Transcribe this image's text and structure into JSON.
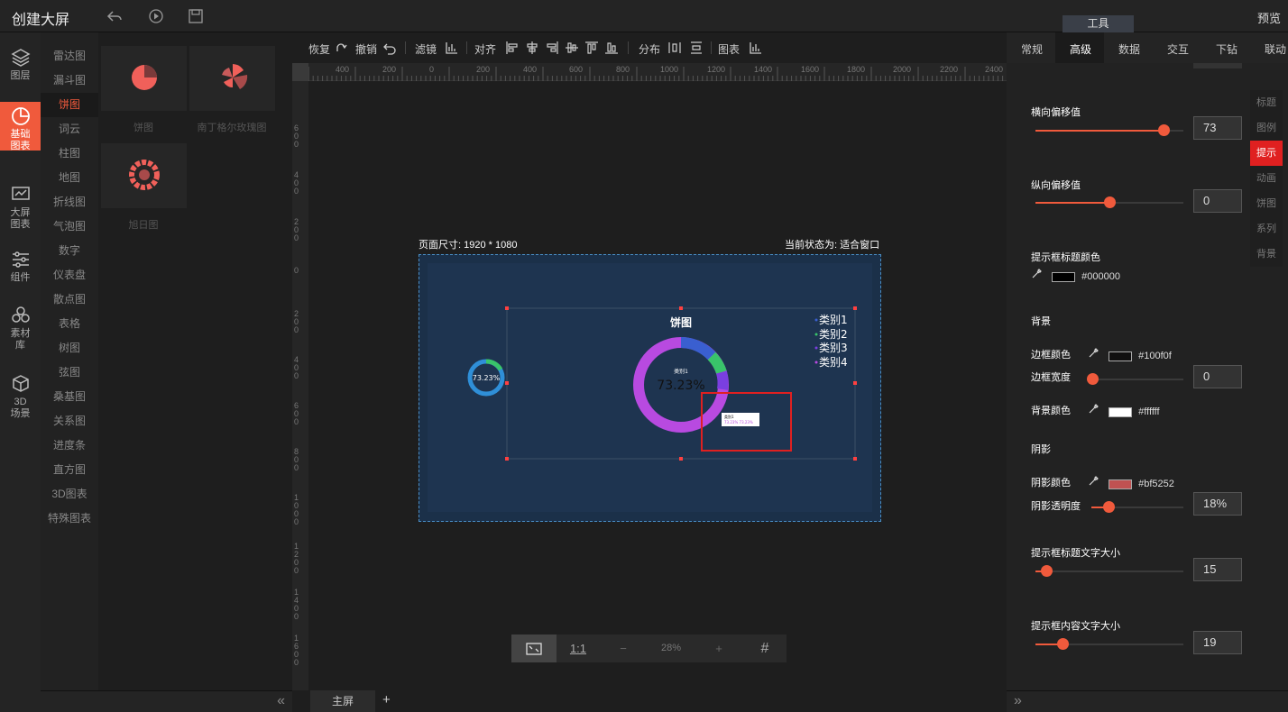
{
  "header": {
    "title": "创建大屏",
    "preview": "预览",
    "tools_tab": "工具"
  },
  "leftnav": [
    {
      "label": "图层",
      "icon": "layers-icon"
    },
    {
      "label": "基础\n图表",
      "icon": "pie-chart-icon",
      "active": true
    },
    {
      "label": "大屏\n图表",
      "icon": "monitor-chart-icon"
    },
    {
      "label": "组件",
      "icon": "sliders-icon"
    },
    {
      "label": "素材\n库",
      "icon": "hexagons-icon"
    },
    {
      "label": "3D\n场景",
      "icon": "cube-icon"
    }
  ],
  "categories": [
    "雷达图",
    "漏斗图",
    "饼图",
    "词云",
    "柱图",
    "地图",
    "折线图",
    "气泡图",
    "数字",
    "仪表盘",
    "散点图",
    "表格",
    "树图",
    "弦图",
    "桑基图",
    "关系图",
    "进度条",
    "直方图",
    "3D图表",
    "特殊图表"
  ],
  "active_category": "饼图",
  "thumbs": [
    {
      "label": "饼图"
    },
    {
      "label": "南丁格尔玫瑰图"
    },
    {
      "label": "旭日图"
    }
  ],
  "toolbar": {
    "redo": "恢复",
    "undo": "撤销",
    "filter": "滤镜",
    "align": "对齐",
    "distribute": "分布",
    "chart": "图表"
  },
  "ruler_h": [
    "400",
    "200",
    "0",
    "200",
    "400",
    "600",
    "800",
    "1000",
    "1200",
    "1400",
    "1600",
    "1800",
    "2000",
    "2200",
    "2400"
  ],
  "ruler_v": [
    "600",
    "400",
    "200",
    "0",
    "200",
    "400",
    "600",
    "800",
    "1000",
    "1200",
    "1400",
    "1600",
    "1800"
  ],
  "canvas": {
    "page_size": "页面尺寸: 1920 * 1080",
    "status": "当前状态为: 适合窗口",
    "pie_title": "饼图",
    "center_value": "73.23%",
    "center_label": "类别1",
    "small_value": "73.23%",
    "legend": [
      "类别1",
      "类别2",
      "类别3",
      "类别4"
    ],
    "tooltip_title": "类别1",
    "tooltip_body": "73.23%  73.23%"
  },
  "zoom": {
    "fit": "⛶",
    "one_to_one": "1:1",
    "minus": "−",
    "level": "28%",
    "plus": "+",
    "grid": "#"
  },
  "bottom": {
    "screen_tab": "主屏",
    "add": "+"
  },
  "right": {
    "tabs": [
      "常规",
      "高级",
      "数据",
      "交互",
      "下钻",
      "联动"
    ],
    "active_tab": "高级",
    "side_tabs": [
      "标题",
      "图例",
      "提示",
      "动画",
      "饼图",
      "系列",
      "背景"
    ],
    "active_side": "提示",
    "h_offset_label": "横向偏移值",
    "h_offset": "73",
    "v_offset_label": "纵向偏移值",
    "v_offset": "0",
    "title_color_label": "提示框标题颜色",
    "title_color": "#000000",
    "bg_section": "背景",
    "border_color_label": "边框颜色",
    "border_color": "#100f0f",
    "border_width_label": "边框宽度",
    "border_width": "0",
    "bg_color_label": "背景颜色",
    "bg_color": "#ffffff",
    "shadow_section": "阴影",
    "shadow_color_label": "阴影颜色",
    "shadow_color": "#bf5252",
    "shadow_opacity_label": "阴影透明度",
    "shadow_opacity": "18%",
    "title_font_label": "提示框标题文字大小",
    "title_font": "15",
    "body_font_label": "提示框内容文字大小",
    "body_font": "19"
  },
  "colors": {
    "accent": "#f05a3c",
    "purple": "#b84ae0",
    "blue": "#3a5fd0",
    "green": "#39c46a",
    "donut_small": "#2f8fd8"
  }
}
